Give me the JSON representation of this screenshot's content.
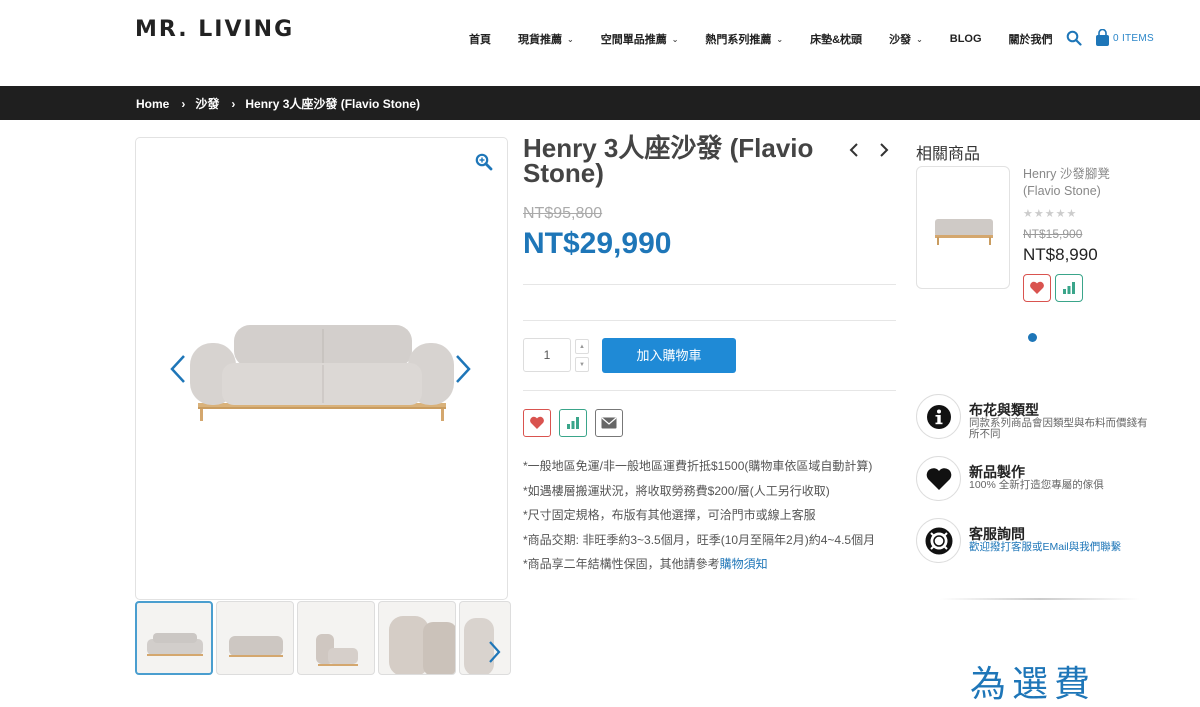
{
  "header": {
    "logo": "MR. LIVING",
    "nav": [
      {
        "label": "首頁",
        "dropdown": false
      },
      {
        "label": "現貨推薦",
        "dropdown": true
      },
      {
        "label": "空間單品推薦",
        "dropdown": true
      },
      {
        "label": "熱門系列推薦",
        "dropdown": true
      },
      {
        "label": "床墊&枕頭",
        "dropdown": false
      },
      {
        "label": "沙發",
        "dropdown": true
      },
      {
        "label": "BLOG",
        "dropdown": false
      },
      {
        "label": "關於我們",
        "dropdown": false
      }
    ],
    "cart_label": "0 ITEMS"
  },
  "breadcrumb": [
    "Home",
    "沙發",
    "Henry 3人座沙發 (Flavio Stone)"
  ],
  "product": {
    "title": "Henry 3人座沙發 (Flavio Stone)",
    "old_price": "NT$95,800",
    "new_price": "NT$29,990",
    "quantity": "1",
    "add_to_cart": "加入購物車",
    "notes": [
      "*一般地區免運/非一般地區運費折抵$1500(購物車依區域自動計算)",
      "*如遇樓層搬運狀況，將收取勞務費$200/層(人工另行收取)",
      "*尺寸固定規格，布版有其他選擇，可洽門市或線上客服",
      "*商品交期: 非旺季約3~3.5個月，旺季(10月至隔年2月)約4~4.5個月"
    ],
    "note_last_prefix": "*商品享二年結構性保固，其他請參考",
    "note_last_link": "購物須知"
  },
  "related": {
    "title": "相關商品",
    "item": {
      "name": "Henry 沙發腳凳 (Flavio Stone)",
      "stars": "★★★★★",
      "old_price": "NT$15,900",
      "new_price": "NT$8,990"
    }
  },
  "features": [
    {
      "title": "布花與類型",
      "desc": "同款系列商品會因類型與布料而價錢有所不同",
      "icon": "info-icon"
    },
    {
      "title": "新品製作",
      "desc": "100% 全新打造您專屬的傢俱",
      "icon": "heart-icon"
    },
    {
      "title": "客服詢問",
      "desc": "歡迎撥打客服或EMail與我們聯繫",
      "icon": "lifebuoy-icon"
    }
  ],
  "bottom_deco": "為選費",
  "colors": {
    "accent": "#1f8ad6",
    "price": "#1e76b8",
    "bar": "#1f1f1f"
  }
}
